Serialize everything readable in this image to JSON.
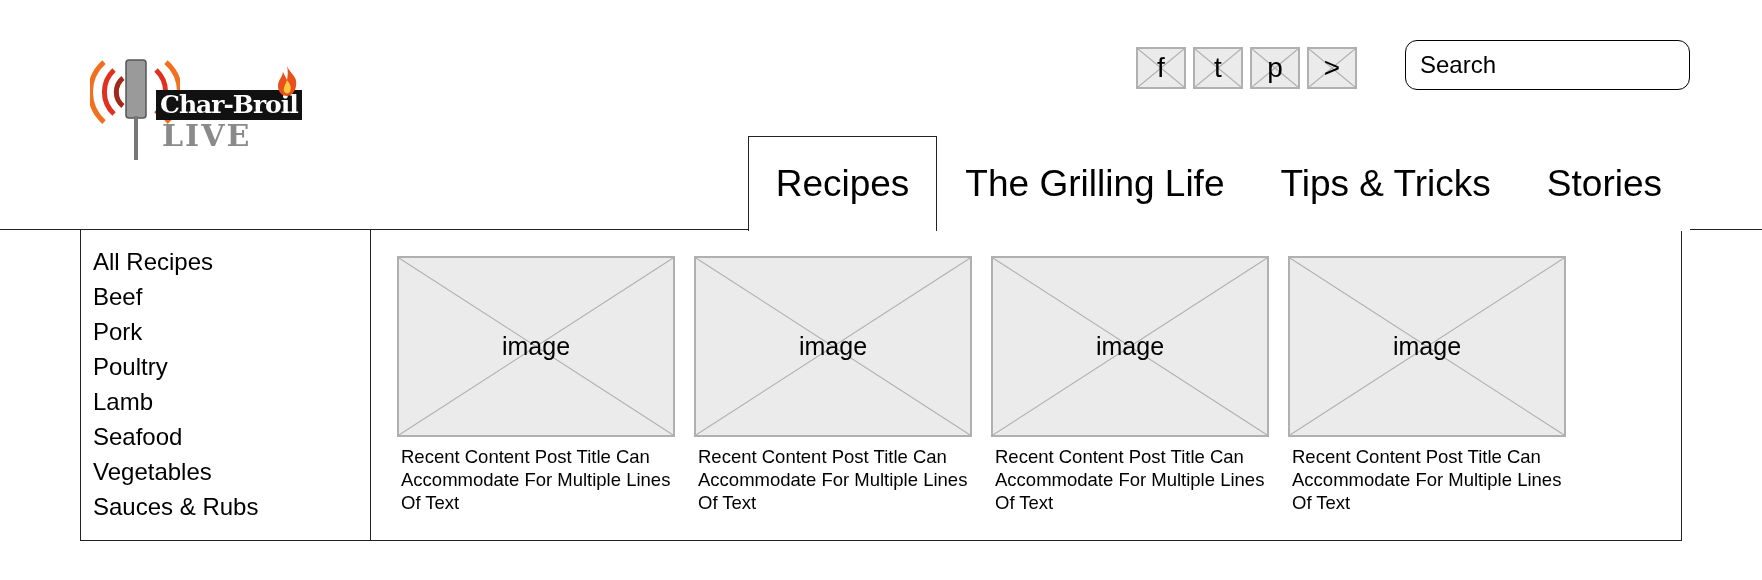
{
  "logo": {
    "brand": "Char-Broil",
    "sub": "LIVE"
  },
  "social": [
    {
      "label": "f"
    },
    {
      "label": "t"
    },
    {
      "label": "p"
    },
    {
      "label": ">"
    }
  ],
  "search": {
    "placeholder": "Search"
  },
  "tabs": [
    {
      "label": "Recipes",
      "selected": true
    },
    {
      "label": "The Grilling Life",
      "selected": false
    },
    {
      "label": "Tips & Tricks",
      "selected": false
    },
    {
      "label": "Stories",
      "selected": false
    }
  ],
  "sidebar": {
    "items": [
      "All Recipes",
      "Beef",
      "Pork",
      "Poultry",
      "Lamb",
      "Seafood",
      "Vegetables",
      "Sauces & Rubs"
    ]
  },
  "cards": [
    {
      "image_label": "image",
      "title": "Recent Content Post Title Can Accommodate For Multiple Lines Of Text"
    },
    {
      "image_label": "image",
      "title": "Recent Content Post Title Can Accommodate For Multiple Lines Of Text"
    },
    {
      "image_label": "image",
      "title": "Recent Content Post Title Can Accommodate For Multiple Lines Of Text"
    },
    {
      "image_label": "image",
      "title": "Recent Content Post Title Can Accommodate For Multiple Lines Of Text"
    }
  ]
}
